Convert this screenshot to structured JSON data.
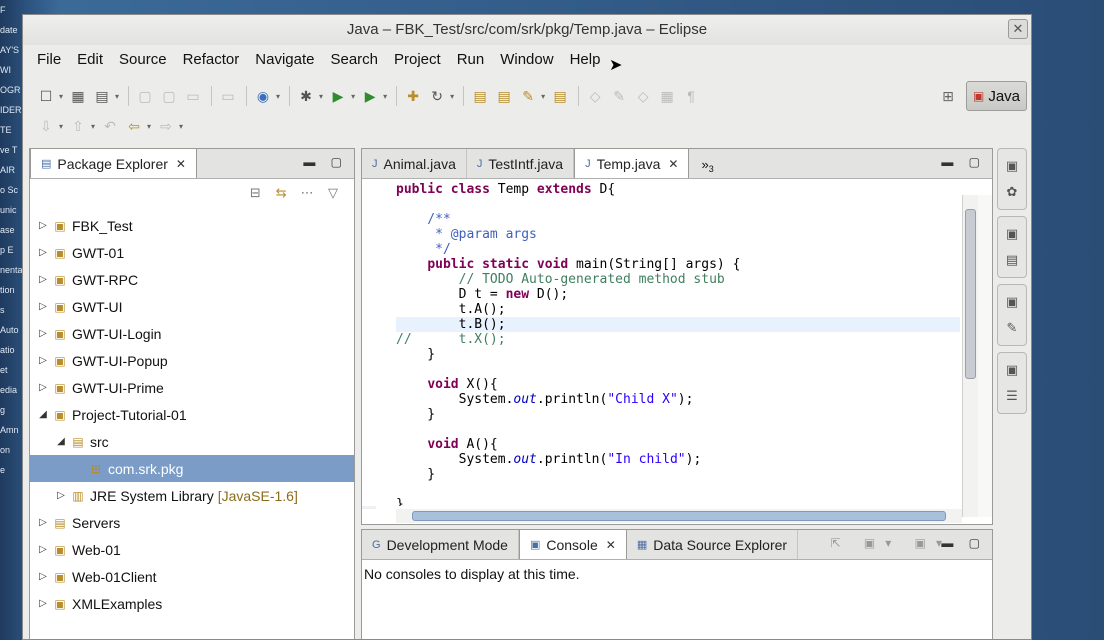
{
  "desktop": {
    "side_text": [
      "F",
      "date",
      "AY'S",
      "WI",
      "OGR",
      "IDER",
      "TE",
      "ve T",
      "AIR",
      "o Sc",
      "unic",
      "ase",
      "p E",
      "nenta",
      "tion",
      "s",
      "Auto",
      "atio",
      "et",
      "edia",
      "g",
      "Amn",
      "on",
      "e"
    ]
  },
  "window": {
    "title": "Java – FBK_Test/src/com/srk/pkg/Temp.java – Eclipse",
    "close_glyph": "✕"
  },
  "menu": [
    "File",
    "Edit",
    "Source",
    "Refactor",
    "Navigate",
    "Search",
    "Project",
    "Run",
    "Window",
    "Help"
  ],
  "toolbar": {
    "row1_icons": [
      "new-icon",
      "save-icon",
      "print-icon",
      "run-icon",
      "debug-icon",
      "search-icon"
    ],
    "row2_icons": [
      "annotation-next-icon",
      "annotation-prev-icon",
      "back-icon",
      "forward-icon"
    ],
    "cursor_glyph": "➤"
  },
  "perspective": {
    "open_glyph": "⊞",
    "label": "Java",
    "more_glyph": "»"
  },
  "package_explorer": {
    "title": "Package Explorer",
    "close_glyph": "✕",
    "minmax": "▬ ▢",
    "tool_glyphs": [
      "⊟",
      "⇆",
      "⋯",
      "▽"
    ],
    "items": [
      {
        "label": "FBK_Test",
        "suffix": "",
        "arrow": "▷",
        "icon": "▣",
        "indent": 0
      },
      {
        "label": "GWT-01",
        "suffix": "",
        "arrow": "▷",
        "icon": "▣",
        "indent": 0
      },
      {
        "label": "GWT-RPC",
        "suffix": "",
        "arrow": "▷",
        "icon": "▣",
        "indent": 0
      },
      {
        "label": "GWT-UI",
        "suffix": "",
        "arrow": "▷",
        "icon": "▣",
        "indent": 0
      },
      {
        "label": "GWT-UI-Login",
        "suffix": "",
        "arrow": "▷",
        "icon": "▣",
        "indent": 0
      },
      {
        "label": "GWT-UI-Popup",
        "suffix": "",
        "arrow": "▷",
        "icon": "▣",
        "indent": 0
      },
      {
        "label": "GWT-UI-Prime",
        "suffix": "",
        "arrow": "▷",
        "icon": "▣",
        "indent": 0
      },
      {
        "label": "Project-Tutorial-01",
        "suffix": "",
        "arrow": "◢",
        "icon": "▣",
        "indent": 0
      },
      {
        "label": "src",
        "suffix": "",
        "arrow": "◢",
        "icon": "▤",
        "indent": 1
      },
      {
        "label": "com.srk.pkg",
        "suffix": "",
        "arrow": "",
        "icon": "⊞",
        "indent": 2,
        "selected": true
      },
      {
        "label": "JRE System Library",
        "suffix": "[JavaSE-1.6]",
        "arrow": "▷",
        "icon": "▥",
        "indent": 1
      },
      {
        "label": "Servers",
        "suffix": "",
        "arrow": "▷",
        "icon": "▤",
        "indent": 0
      },
      {
        "label": "Web-01",
        "suffix": "",
        "arrow": "▷",
        "icon": "▣",
        "indent": 0
      },
      {
        "label": "Web-01Client",
        "suffix": "",
        "arrow": "▷",
        "icon": "▣",
        "indent": 0
      },
      {
        "label": "XMLExamples",
        "suffix": "",
        "arrow": "▷",
        "icon": "▣",
        "indent": 0
      }
    ]
  },
  "editor": {
    "tabs": [
      {
        "label": "Animal.java",
        "active": false,
        "icon": "J"
      },
      {
        "label": "TestIntf.java",
        "active": false,
        "icon": "J"
      },
      {
        "label": "Temp.java",
        "active": true,
        "icon": "J"
      }
    ],
    "close_glyph": "✕",
    "overflow": "»",
    "overflow_count": "3",
    "minmax": "▬ ▢",
    "fold_glyph": "⊖",
    "code_lines": [
      [
        {
          "t": "public class ",
          "c": "kw"
        },
        {
          "t": "Temp ",
          "c": ""
        },
        {
          "t": "extends ",
          "c": "kw"
        },
        {
          "t": "D{",
          "c": ""
        }
      ],
      [],
      [
        {
          "t": "    /**",
          "c": "jd"
        }
      ],
      [
        {
          "t": "     * @param args",
          "c": "jd"
        }
      ],
      [
        {
          "t": "     */",
          "c": "jd"
        }
      ],
      [
        {
          "t": "    ",
          "c": ""
        },
        {
          "t": "public static void ",
          "c": "kw"
        },
        {
          "t": "main(String[] args) {",
          "c": ""
        }
      ],
      [
        {
          "t": "        // TODO Auto-generated method stub",
          "c": "cm"
        }
      ],
      [
        {
          "t": "        D t = ",
          "c": ""
        },
        {
          "t": "new ",
          "c": "kw"
        },
        {
          "t": "D();",
          "c": ""
        }
      ],
      [
        {
          "t": "        t.A();",
          "c": ""
        }
      ],
      [
        {
          "t": "        t.B();",
          "c": ""
        }
      ],
      [
        {
          "t": "//      t.X();",
          "c": "cm"
        }
      ],
      [
        {
          "t": "    }",
          "c": ""
        }
      ],
      [],
      [
        {
          "t": "    ",
          "c": ""
        },
        {
          "t": "void ",
          "c": "kw"
        },
        {
          "t": "X(){",
          "c": ""
        }
      ],
      [
        {
          "t": "        System.",
          "c": ""
        },
        {
          "t": "out",
          "c": "it"
        },
        {
          "t": ".println(",
          "c": ""
        },
        {
          "t": "\"Child X\"",
          "c": "str"
        },
        {
          "t": ");",
          "c": ""
        }
      ],
      [
        {
          "t": "    }",
          "c": ""
        }
      ],
      [],
      [
        {
          "t": "    ",
          "c": ""
        },
        {
          "t": "void ",
          "c": "kw"
        },
        {
          "t": "A(){",
          "c": ""
        }
      ],
      [
        {
          "t": "        System.",
          "c": ""
        },
        {
          "t": "out",
          "c": "it"
        },
        {
          "t": ".println(",
          "c": ""
        },
        {
          "t": "\"In child\"",
          "c": "str"
        },
        {
          "t": ");",
          "c": ""
        }
      ],
      [
        {
          "t": "    }",
          "c": ""
        }
      ],
      [],
      [
        {
          "t": "}",
          "c": ""
        }
      ]
    ],
    "fold_lines": [
      2,
      5,
      13,
      17
    ],
    "highlight_line": 9
  },
  "bottom": {
    "tabs": [
      {
        "label": "Development Mode",
        "active": false,
        "icon": "G"
      },
      {
        "label": "Console",
        "active": true,
        "icon": "▣"
      },
      {
        "label": "Data Source Explorer",
        "active": false,
        "icon": "▦"
      }
    ],
    "close_glyph": "✕",
    "tool_glyphs": "⇱ ▣▾ ▣▾",
    "minmax": "▬ ▢",
    "message": "No consoles to display at this time."
  },
  "trim": {
    "groups": [
      [
        "▣",
        "✿"
      ],
      [
        "▣",
        "▤"
      ],
      [
        "▣",
        "✎"
      ],
      [
        "▣",
        "☰"
      ]
    ]
  }
}
